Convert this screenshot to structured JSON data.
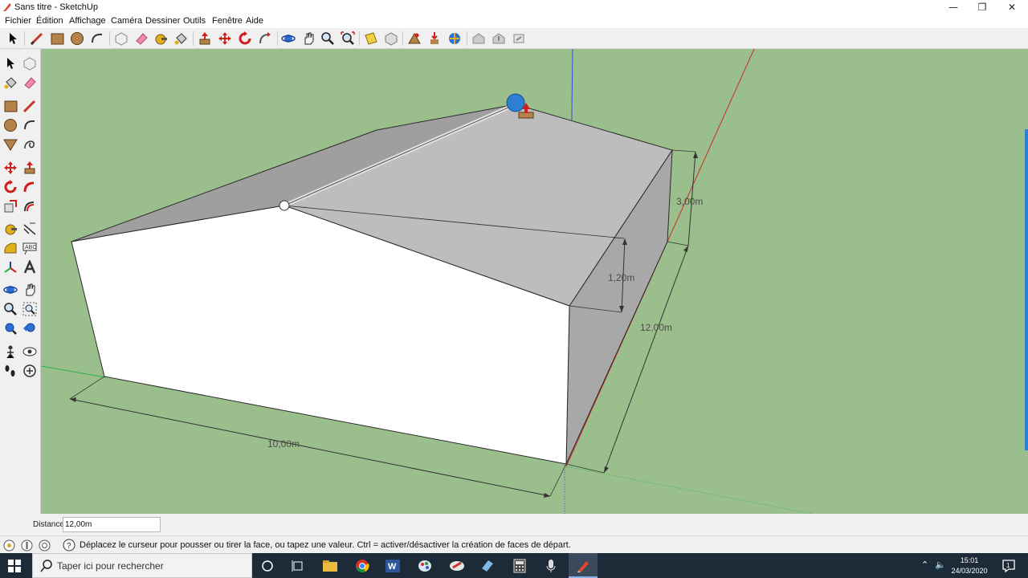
{
  "window": {
    "title": "Sans titre - SketchUp",
    "minimize": "—",
    "maximize": "❐",
    "close": "✕"
  },
  "menu": [
    "Fichier",
    "Édition",
    "Affichage",
    "Caméra",
    "Dessiner",
    "Outils",
    "Fenêtre",
    "Aide"
  ],
  "toolbar_icons": [
    "select",
    "line",
    "rectangle",
    "circle",
    "arc",
    "make-component",
    "eraser",
    "tape-measure",
    "paint-bucket",
    "push-pull",
    "move",
    "rotate",
    "follow-me",
    "orbit",
    "pan",
    "zoom",
    "zoom-extents",
    "section-plane",
    "previous-view",
    "add-location",
    "get-models",
    "extension-warehouse",
    "3d-warehouse",
    "share-model",
    "layout"
  ],
  "left_toolbar_icons": [
    "select",
    "make-component",
    "paint-bucket",
    "eraser",
    "rectangle",
    "line",
    "circle",
    "arc",
    "polygon",
    "freehand",
    "move",
    "push-pull",
    "rotate",
    "follow-me",
    "scale",
    "offset",
    "tape-measure",
    "text",
    "axes",
    "3d-text",
    "orbit",
    "pan",
    "zoom",
    "zoom-window",
    "zoom-extents",
    "previous",
    "position-camera",
    "look-around",
    "walk",
    "section-plane"
  ],
  "viewport": {
    "dimensions": {
      "width": "10,00m",
      "depth": "12,00m",
      "height": "3,00m",
      "roof": "1,20m"
    },
    "colors": {
      "ground": "#9bbf8c",
      "front_face": "#ffffff",
      "roof_face": "#bdbdbd",
      "side_face": "#a8a8a8",
      "red_axis": "#cc2a2a",
      "green_axis": "#2bb24c",
      "blue_axis": "#3a4bd8",
      "selection": "#2d7fd4"
    }
  },
  "vcb": {
    "label": "Distance",
    "value": "12,00m"
  },
  "status": {
    "hint": "Déplacez le curseur pour pousser ou tirer la face, ou tapez une valeur.  Ctrl = activer/désactiver la création de faces de départ."
  },
  "taskbar": {
    "search_placeholder": "Taper ici pour rechercher",
    "time": "15:01",
    "date": "24/03/2020",
    "notification_count": "1"
  }
}
